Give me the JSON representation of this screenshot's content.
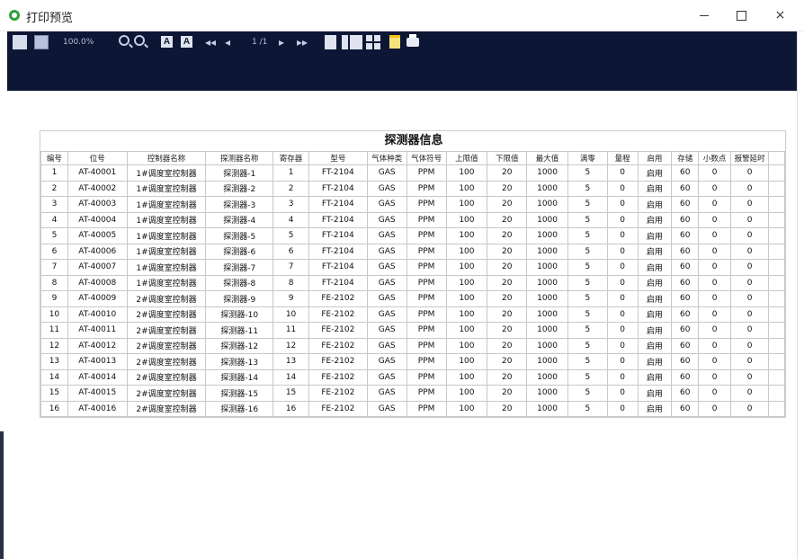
{
  "window": {
    "title": "打印预览",
    "controls": {
      "minimize": "–",
      "maximize": "",
      "close": "×"
    }
  },
  "toolbar": {
    "zoom": "100.0%",
    "page_indicator": "1 /1",
    "buttons": [
      "page-setup-icon",
      "fit-page-icon",
      "zoom-out-icon",
      "zoom-in-icon",
      "font-a-icon",
      "font-b-icon",
      "first-page-icon",
      "previous-page-icon",
      "next-page-icon",
      "last-page-icon",
      "single-page-icon",
      "two-page-icon",
      "four-page-icon",
      "export-icon",
      "print-icon"
    ]
  },
  "report": {
    "title": "探测器信息",
    "columns": [
      "编号",
      "位号",
      "控制器名称",
      "探测器名称",
      "寄存器",
      "型号",
      "气体种类",
      "气体符号",
      "上限值",
      "下限值",
      "最大值",
      "满零",
      "量程",
      "启用",
      "存储",
      "小数点",
      "报警延时"
    ],
    "rows": [
      [
        "1",
        "AT-40001",
        "1#调度室控制器",
        "探测器-1",
        "1",
        "FT-2104",
        "GAS",
        "PPM",
        "100",
        "20",
        "1000",
        "5",
        "0",
        "启用",
        "60",
        "0",
        "0"
      ],
      [
        "2",
        "AT-40002",
        "1#调度室控制器",
        "探测器-2",
        "2",
        "FT-2104",
        "GAS",
        "PPM",
        "100",
        "20",
        "1000",
        "5",
        "0",
        "启用",
        "60",
        "0",
        "0"
      ],
      [
        "3",
        "AT-40003",
        "1#调度室控制器",
        "探测器-3",
        "3",
        "FT-2104",
        "GAS",
        "PPM",
        "100",
        "20",
        "1000",
        "5",
        "0",
        "启用",
        "60",
        "0",
        "0"
      ],
      [
        "4",
        "AT-40004",
        "1#调度室控制器",
        "探测器-4",
        "4",
        "FT-2104",
        "GAS",
        "PPM",
        "100",
        "20",
        "1000",
        "5",
        "0",
        "启用",
        "60",
        "0",
        "0"
      ],
      [
        "5",
        "AT-40005",
        "1#调度室控制器",
        "探测器-5",
        "5",
        "FT-2104",
        "GAS",
        "PPM",
        "100",
        "20",
        "1000",
        "5",
        "0",
        "启用",
        "60",
        "0",
        "0"
      ],
      [
        "6",
        "AT-40006",
        "1#调度室控制器",
        "探测器-6",
        "6",
        "FT-2104",
        "GAS",
        "PPM",
        "100",
        "20",
        "1000",
        "5",
        "0",
        "启用",
        "60",
        "0",
        "0"
      ],
      [
        "7",
        "AT-40007",
        "1#调度室控制器",
        "探测器-7",
        "7",
        "FT-2104",
        "GAS",
        "PPM",
        "100",
        "20",
        "1000",
        "5",
        "0",
        "启用",
        "60",
        "0",
        "0"
      ],
      [
        "8",
        "AT-40008",
        "1#调度室控制器",
        "探测器-8",
        "8",
        "FT-2104",
        "GAS",
        "PPM",
        "100",
        "20",
        "1000",
        "5",
        "0",
        "启用",
        "60",
        "0",
        "0"
      ],
      [
        "9",
        "AT-40009",
        "2#调度室控制器",
        "探测器-9",
        "9",
        "FE-2102",
        "GAS",
        "PPM",
        "100",
        "20",
        "1000",
        "5",
        "0",
        "启用",
        "60",
        "0",
        "0"
      ],
      [
        "10",
        "AT-40010",
        "2#调度室控制器",
        "探测器-10",
        "10",
        "FE-2102",
        "GAS",
        "PPM",
        "100",
        "20",
        "1000",
        "5",
        "0",
        "启用",
        "60",
        "0",
        "0"
      ],
      [
        "11",
        "AT-40011",
        "2#调度室控制器",
        "探测器-11",
        "11",
        "FE-2102",
        "GAS",
        "PPM",
        "100",
        "20",
        "1000",
        "5",
        "0",
        "启用",
        "60",
        "0",
        "0"
      ],
      [
        "12",
        "AT-40012",
        "2#调度室控制器",
        "探测器-12",
        "12",
        "FE-2102",
        "GAS",
        "PPM",
        "100",
        "20",
        "1000",
        "5",
        "0",
        "启用",
        "60",
        "0",
        "0"
      ],
      [
        "13",
        "AT-40013",
        "2#调度室控制器",
        "探测器-13",
        "13",
        "FE-2102",
        "GAS",
        "PPM",
        "100",
        "20",
        "1000",
        "5",
        "0",
        "启用",
        "60",
        "0",
        "0"
      ],
      [
        "14",
        "AT-40014",
        "2#调度室控制器",
        "探测器-14",
        "14",
        "FE-2102",
        "GAS",
        "PPM",
        "100",
        "20",
        "1000",
        "5",
        "0",
        "启用",
        "60",
        "0",
        "0"
      ],
      [
        "15",
        "AT-40015",
        "2#调度室控制器",
        "探测器-15",
        "15",
        "FE-2102",
        "GAS",
        "PPM",
        "100",
        "20",
        "1000",
        "5",
        "0",
        "启用",
        "60",
        "0",
        "0"
      ],
      [
        "16",
        "AT-40016",
        "2#调度室控制器",
        "探测器-16",
        "16",
        "FE-2102",
        "GAS",
        "PPM",
        "100",
        "20",
        "1000",
        "5",
        "0",
        "启用",
        "60",
        "0",
        "0"
      ]
    ]
  },
  "colors": {
    "toolbar_bg": "#0d1634",
    "app_icon": "#2fa23a"
  }
}
